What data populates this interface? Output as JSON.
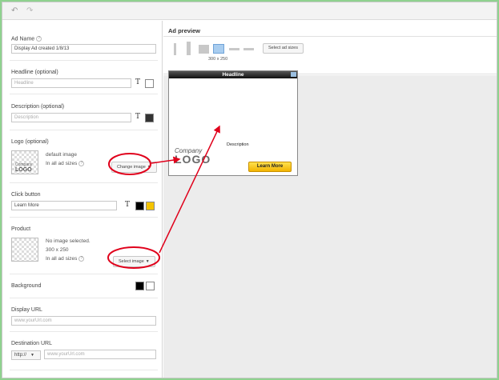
{
  "toolbar": {
    "undo_icon": "↶",
    "redo_icon": "↷"
  },
  "form": {
    "ad_name": {
      "label": "Ad Name",
      "help": "?",
      "value": "Display Ad created 1/8/13"
    },
    "headline": {
      "label": "Headline (optional)",
      "placeholder": "Headline",
      "text_icon": "T"
    },
    "description": {
      "label": "Description (optional)",
      "placeholder": "Description",
      "text_icon": "T"
    },
    "logo": {
      "label": "Logo (optional)",
      "status": "default image",
      "sizes": "In all ad sizes",
      "help": "?",
      "button": "Change image",
      "thumb_company": "Company",
      "thumb_logo": "LOGO"
    },
    "click_button": {
      "label": "Click button",
      "value": "Learn More",
      "text_icon": "T"
    },
    "product": {
      "label": "Product",
      "status": "No image selected.",
      "dimensions": "300 x 250",
      "sizes": "In all ad sizes",
      "help": "?",
      "button": "Select image"
    },
    "background": {
      "label": "Background"
    },
    "display_url": {
      "label": "Display URL",
      "placeholder": "www.yourUrl.com"
    },
    "destination_url": {
      "label": "Destination URL",
      "protocol": "http://",
      "placeholder": "www.yourUrl.com"
    }
  },
  "preview": {
    "title": "Ad preview",
    "selected_size": "300 x 250",
    "select_sizes_button": "Select ad sizes",
    "ad": {
      "headline": "Headline",
      "description": "Description",
      "logo_company": "Company",
      "logo_text": "LOGO",
      "button": "Learn More"
    }
  },
  "colors": {
    "button_yellow": "#f5c400",
    "annotation_red": "#e0001b",
    "page_bg": "#8fd28f"
  }
}
